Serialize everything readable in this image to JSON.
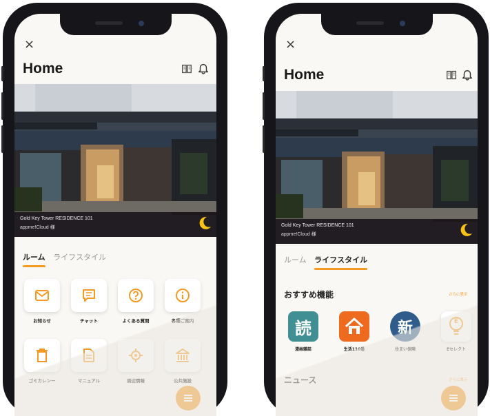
{
  "colors": {
    "accent": "#f39a25",
    "hero_overlay": "#1e161a",
    "screen_bg": "#faf8f4",
    "phone_body": "#16161a"
  },
  "left_screen": {
    "close_glyph": "×",
    "title": "Home",
    "header_icons": [
      "book-icon",
      "bell-icon"
    ],
    "hero": {
      "line1": "Gold Key Tower RESIDENCE 101",
      "line2": "appme!Cloud 様",
      "icon": "moon-icon"
    },
    "tabs": [
      {
        "label": "ルーム",
        "active": true
      },
      {
        "label": "ライフスタイル",
        "active": false
      }
    ],
    "tiles": [
      {
        "label": "お知らせ",
        "icon": "mail-icon"
      },
      {
        "label": "チャット",
        "icon": "chat-icon"
      },
      {
        "label": "よくある質問",
        "icon": "question-icon"
      },
      {
        "label": "各種ご案内",
        "icon": "info-icon"
      },
      {
        "label": "ゴミカレンー",
        "icon": "trash-icon"
      },
      {
        "label": "マニュアル",
        "icon": "document-icon"
      },
      {
        "label": "周辺情報",
        "icon": "location-icon"
      },
      {
        "label": "公共施設",
        "icon": "building-icon"
      }
    ],
    "fab_icon": "menu-icon"
  },
  "right_screen": {
    "close_glyph": "×",
    "title": "Home",
    "header_icons": [
      "book-icon",
      "bell-icon"
    ],
    "hero": {
      "line1": "Gold Key Tower RESIDENCE 101",
      "line2": "appme!Cloud 様",
      "icon": "moon-icon"
    },
    "tabs": [
      {
        "label": "ルーム",
        "active": false
      },
      {
        "label": "ライフスタイル",
        "active": true
      }
    ],
    "recommended": {
      "title": "おすすめ機能",
      "more": "さらに表示",
      "apps": [
        {
          "label": "漫画雑誌",
          "glyph": "読",
          "bg": "#3f8f93",
          "icon": "magazine-icon"
        },
        {
          "label": "生活110番",
          "glyph": "",
          "bg": "#ee6a1f",
          "icon": "house-icon"
        },
        {
          "label": "住まい保険",
          "glyph": "新",
          "bg": "#2f5c8a",
          "icon": "insurance-icon"
        },
        {
          "label": "Eセレクト",
          "glyph": "E",
          "bg": "#ffffff",
          "icon": "bulb-icon"
        }
      ]
    },
    "news": {
      "title": "ニュース",
      "more": "さらに表示"
    },
    "fab_icon": "menu-icon"
  }
}
